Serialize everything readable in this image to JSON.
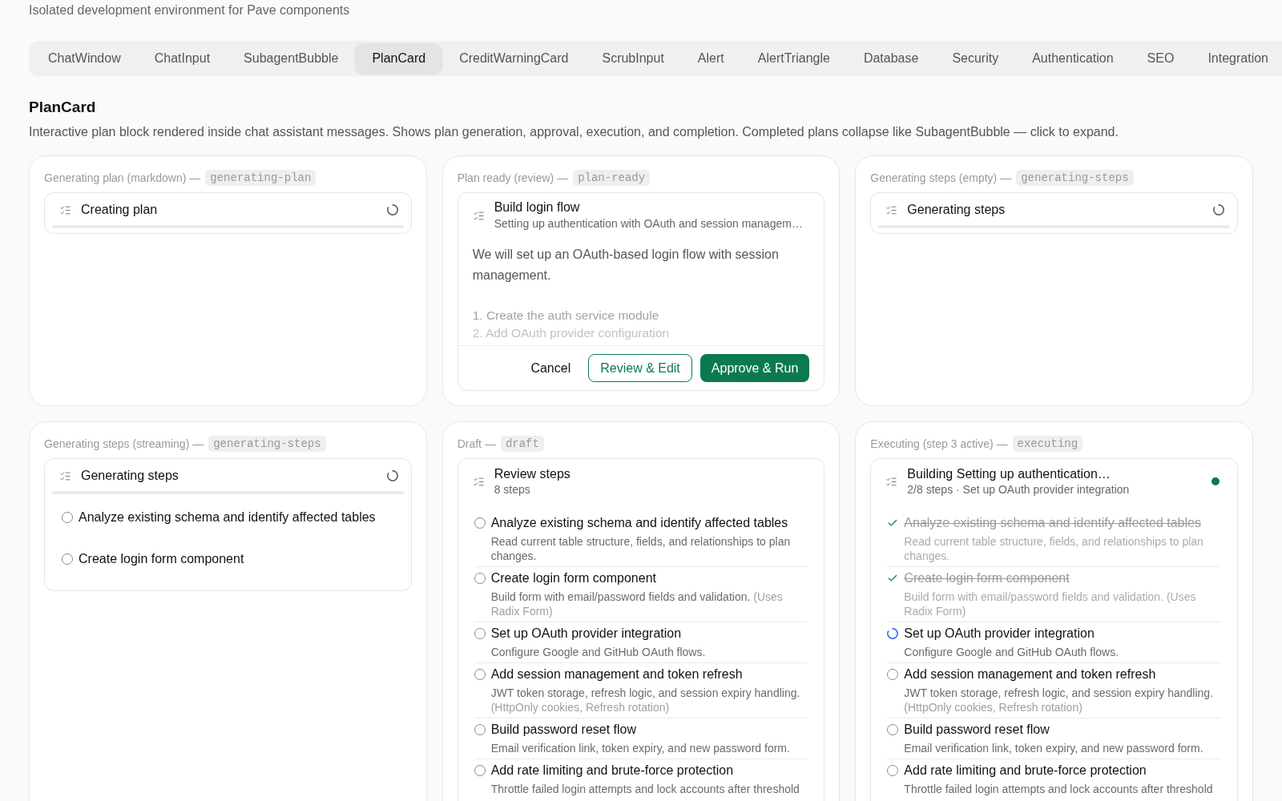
{
  "page": {
    "subtitle": "Isolated development environment for Pave components"
  },
  "tabs": [
    {
      "label": "ChatWindow",
      "selected": false
    },
    {
      "label": "ChatInput",
      "selected": false
    },
    {
      "label": "SubagentBubble",
      "selected": false
    },
    {
      "label": "PlanCard",
      "selected": true
    },
    {
      "label": "CreditWarningCard",
      "selected": false
    },
    {
      "label": "ScrubInput",
      "selected": false
    },
    {
      "label": "Alert",
      "selected": false
    },
    {
      "label": "AlertTriangle",
      "selected": false
    },
    {
      "label": "Database",
      "selected": false
    },
    {
      "label": "Security",
      "selected": false
    },
    {
      "label": "Authentication",
      "selected": false
    },
    {
      "label": "SEO",
      "selected": false
    },
    {
      "label": "Integration",
      "selected": false
    }
  ],
  "section": {
    "title": "PlanCard",
    "description": "Interactive plan block rendered inside chat assistant messages. Shows plan generation, approval, execution, and completion. Completed plans collapse like SubagentBubble — click to expand."
  },
  "cards": [
    {
      "label": "Generating plan (markdown) —",
      "state_code": "generating-plan",
      "plan": {
        "kind": "loading",
        "title": "Creating plan",
        "loading": true,
        "running": false
      }
    },
    {
      "label": "Plan ready (review) —",
      "state_code": "plan-ready",
      "plan": {
        "kind": "review",
        "title": "Build login flow",
        "subtitle": "Setting up authentication with OAuth and session managem…",
        "loading": false,
        "running": false,
        "body": {
          "paragraph": "We will set up an OAuth-based login flow with session management.",
          "list": [
            "1. Create the auth service module",
            "2. Add OAuth provider configuration"
          ]
        },
        "actions": [
          {
            "label": "Cancel",
            "kind": "ghost"
          },
          {
            "label": "Review & Edit",
            "kind": "outline"
          },
          {
            "label": "Approve & Run",
            "kind": "primary"
          }
        ]
      }
    },
    {
      "label": "Generating steps (empty) —",
      "state_code": "generating-steps",
      "plan": {
        "kind": "loading",
        "title": "Generating steps",
        "loading": true,
        "running": false
      }
    },
    {
      "label": "Generating steps (streaming) —",
      "state_code": "generating-steps",
      "plan": {
        "kind": "loading",
        "title": "Generating steps",
        "loading": true,
        "running": false,
        "steps": [
          {
            "title": "Analyze existing schema and identify affected tables",
            "done": false,
            "active": false
          },
          {
            "title": "Create login form component",
            "done": false,
            "active": false
          }
        ]
      }
    },
    {
      "label": "Draft —",
      "state_code": "draft",
      "plan": {
        "kind": "steps",
        "title": "Review steps",
        "subtitle": "8 steps",
        "loading": false,
        "running": false,
        "steps": [
          {
            "title": "Analyze existing schema and identify affected tables",
            "description": "Read current table structure, fields, and relationships to plan changes.",
            "done": false,
            "active": false
          },
          {
            "title": "Create login form component",
            "description": "Build form with email/password fields and validation.",
            "note": "(Uses Radix Form)",
            "done": false,
            "active": false
          },
          {
            "title": "Set up OAuth provider integration",
            "description": "Configure Google and GitHub OAuth flows.",
            "done": false,
            "active": false
          },
          {
            "title": "Add session management and token refresh",
            "description": "JWT token storage, refresh logic, and session expiry handling.",
            "note": "(HttpOnly cookies, Refresh rotation)",
            "done": false,
            "active": false
          },
          {
            "title": "Build password reset flow",
            "description": "Email verification link, token expiry, and new password form.",
            "done": false,
            "active": false
          },
          {
            "title": "Add rate limiting and brute-force protection",
            "description": "Throttle failed login attempts and lock accounts after threshold",
            "done": false,
            "active": false
          }
        ]
      }
    },
    {
      "label": "Executing (step 3 active) —",
      "state_code": "executing",
      "plan": {
        "kind": "steps",
        "title": "Building Setting up authentication…",
        "subtitle": "2/8 steps · Set up OAuth provider integration",
        "loading": false,
        "running": true,
        "steps": [
          {
            "title": "Analyze existing schema and identify affected tables",
            "description": "Read current table structure, fields, and relationships to plan changes.",
            "done": true,
            "active": false
          },
          {
            "title": "Create login form component",
            "description": "Build form with email/password fields and validation.",
            "note": "(Uses Radix Form)",
            "done": true,
            "active": false
          },
          {
            "title": "Set up OAuth provider integration",
            "description": "Configure Google and GitHub OAuth flows.",
            "done": false,
            "active": true
          },
          {
            "title": "Add session management and token refresh",
            "description": "JWT token storage, refresh logic, and session expiry handling.",
            "note": "(HttpOnly cookies, Refresh rotation)",
            "done": false,
            "active": false
          },
          {
            "title": "Build password reset flow",
            "description": "Email verification link, token expiry, and new password form.",
            "done": false,
            "active": false
          },
          {
            "title": "Add rate limiting and brute-force protection",
            "description": "Throttle failed login attempts and lock accounts after threshold",
            "done": false,
            "active": false
          }
        ]
      }
    }
  ]
}
